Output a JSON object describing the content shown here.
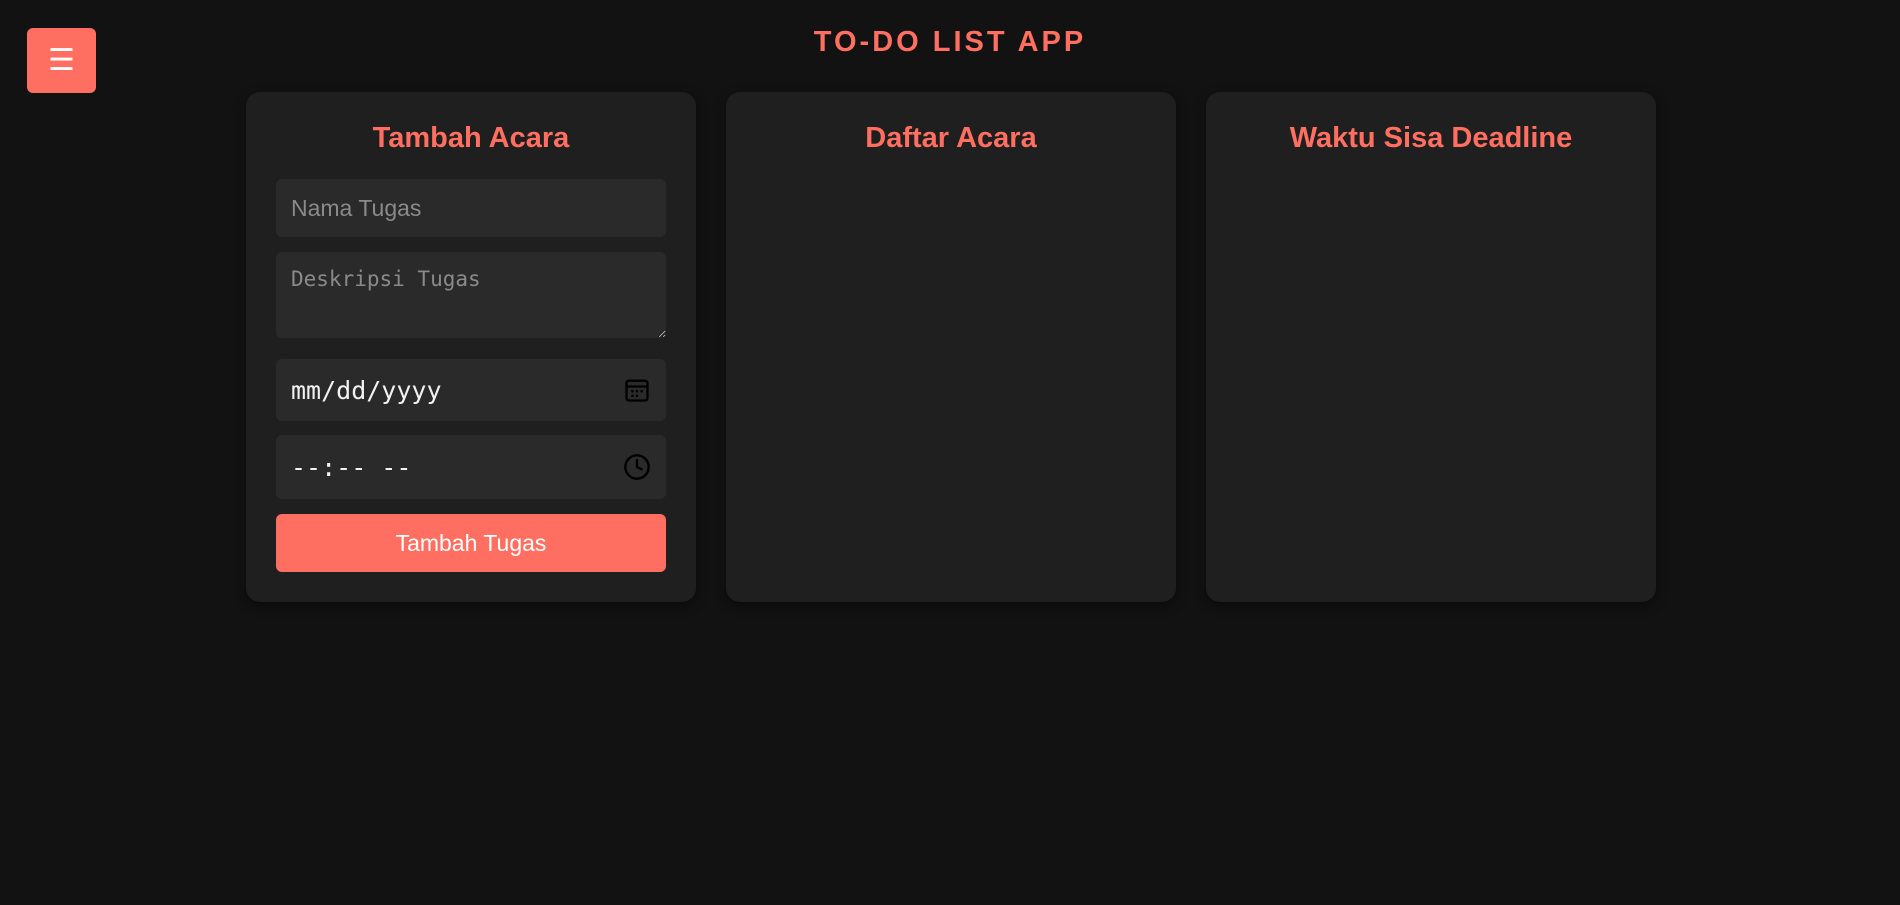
{
  "header": {
    "menu_icon": "☰",
    "title": "TO-DO LIST APP"
  },
  "add_panel": {
    "title": "Tambah Acara",
    "task_name_placeholder": "Nama Tugas",
    "task_description_placeholder": "Deskripsi Tugas",
    "date_value": "mm/dd/yyyy",
    "time_value": "--:-- --",
    "submit_label": "Tambah Tugas"
  },
  "list_panel": {
    "title": "Daftar Acara",
    "items": []
  },
  "deadline_panel": {
    "title": "Waktu Sisa Deadline",
    "items": []
  },
  "colors": {
    "accent": "#ff6f61",
    "background": "#121212",
    "panel": "#1f1f1f",
    "field": "#2a2a2a"
  },
  "icons": {
    "menu": "hamburger-menu-icon",
    "date": "calendar-icon",
    "time": "clock-icon"
  }
}
